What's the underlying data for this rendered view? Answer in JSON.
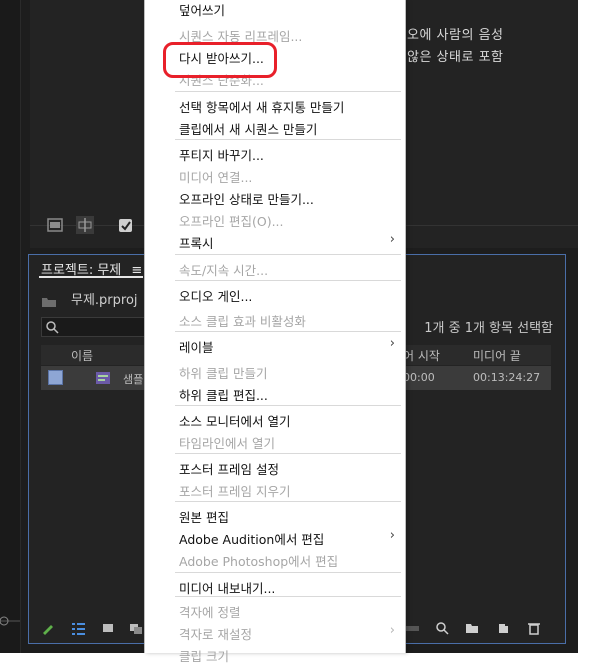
{
  "background_text": {
    "line1": "오에 사람의 음성",
    "line2": "않은 상태로 포함"
  },
  "project_panel": {
    "tab_label": "프로젝트: 무제",
    "tab_more": "≡",
    "file_name": "무제.prproj",
    "selection_status": "1개 중 1개 항목 선택함",
    "columns": {
      "name": "이름",
      "media_start": "어 시작",
      "media_end": "미디어 끝"
    },
    "row": {
      "name": "샘플",
      "media_start": "00:00",
      "media_end": "00:13:24:27"
    }
  },
  "context_menu": {
    "items": [
      {
        "label": "덮어쓰기",
        "enabled": true
      },
      {
        "label": "시퀀스 자동 리프레임...",
        "enabled": false
      },
      {
        "label": "다시 받아쓰기...",
        "enabled": true,
        "highlighted": true
      },
      {
        "label": "시퀀스 단순화...",
        "enabled": false
      },
      {
        "label": "선택 항목에서 새 휴지통 만들기",
        "enabled": true
      },
      {
        "label": "클립에서 새 시퀀스 만들기",
        "enabled": true
      },
      {
        "label": "푸티지 바꾸기...",
        "enabled": true
      },
      {
        "label": "미디어 연결...",
        "enabled": false
      },
      {
        "label": "오프라인 상태로 만들기...",
        "enabled": true
      },
      {
        "label": "오프라인 편집(O)...",
        "enabled": false
      },
      {
        "label": "프록시",
        "enabled": true,
        "submenu": true
      },
      {
        "label": "속도/지속 시간...",
        "enabled": false
      },
      {
        "label": "오디오 게인...",
        "enabled": true
      },
      {
        "label": "소스 클립 효과 비활성화",
        "enabled": false
      },
      {
        "label": "레이블",
        "enabled": true,
        "submenu": true
      },
      {
        "label": "하위 클립 만들기",
        "enabled": false
      },
      {
        "label": "하위 클립 편집...",
        "enabled": true
      },
      {
        "label": "소스 모니터에서 열기",
        "enabled": true
      },
      {
        "label": "타임라인에서 열기",
        "enabled": false
      },
      {
        "label": "포스터 프레임 설정",
        "enabled": true
      },
      {
        "label": "포스터 프레임 지우기",
        "enabled": false
      },
      {
        "label": "원본 편집",
        "enabled": true
      },
      {
        "label": "Adobe Audition에서 편집",
        "enabled": true,
        "submenu": true
      },
      {
        "label": "Adobe Photoshop에서 편집",
        "enabled": false
      },
      {
        "label": "미디어 내보내기...",
        "enabled": true
      },
      {
        "label": "격자에 정렬",
        "enabled": false
      },
      {
        "label": "격자로 재설정",
        "enabled": false,
        "submenu": true
      },
      {
        "label": "클립 크기",
        "enabled": false
      }
    ]
  },
  "colors": {
    "highlight_border": "#e8202a",
    "panel_focus_border": "#4a6ea8",
    "app_background": "#1d1d1d"
  }
}
